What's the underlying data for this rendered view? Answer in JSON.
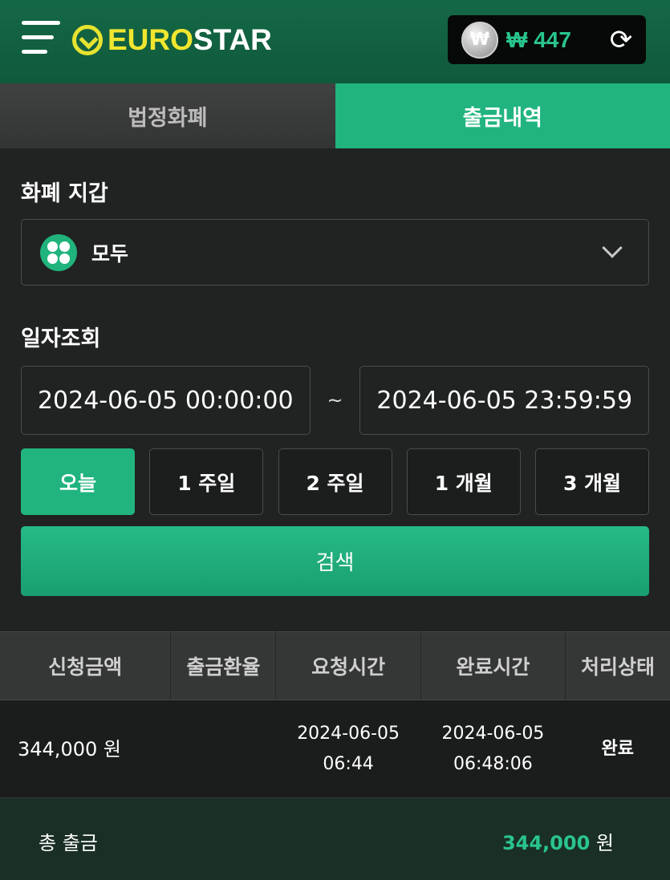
{
  "header": {
    "logo_euro": "EURO",
    "logo_star": "STAR",
    "wallet_currency": "₩",
    "balance": "₩ 447"
  },
  "tabs": [
    {
      "label": "법정화폐",
      "active": false
    },
    {
      "label": "출금내역",
      "active": true
    }
  ],
  "filters": {
    "wallet_label": "화폐 지갑",
    "wallet_selected": "모두",
    "date_label": "일자조회",
    "start_date": "2024-06-05 00:00:00",
    "separator": "~",
    "end_date": "2024-06-05 23:59:59",
    "quick_ranges": [
      {
        "label": "오늘",
        "active": true
      },
      {
        "label": "1 주일",
        "active": false
      },
      {
        "label": "2 주일",
        "active": false
      },
      {
        "label": "1 개월",
        "active": false
      },
      {
        "label": "3 개월",
        "active": false
      }
    ],
    "search_label": "검색"
  },
  "table": {
    "columns": [
      "신청금액",
      "출금환율",
      "요청시간",
      "완료시간",
      "처리상태"
    ],
    "rows": [
      {
        "amount": "344,000 원",
        "rate": "",
        "request_date": "2024-06-05",
        "request_time": "06:44",
        "complete_date": "2024-06-05",
        "complete_time": "06:48:06",
        "status": "완료"
      }
    ]
  },
  "total": {
    "label": "총 출금",
    "amount": "344,000",
    "unit": "원"
  },
  "colors": {
    "accent": "#21b47e",
    "header": "#156846",
    "status_done": "#4cc75a",
    "logo_yellow": "#f0e62f"
  }
}
